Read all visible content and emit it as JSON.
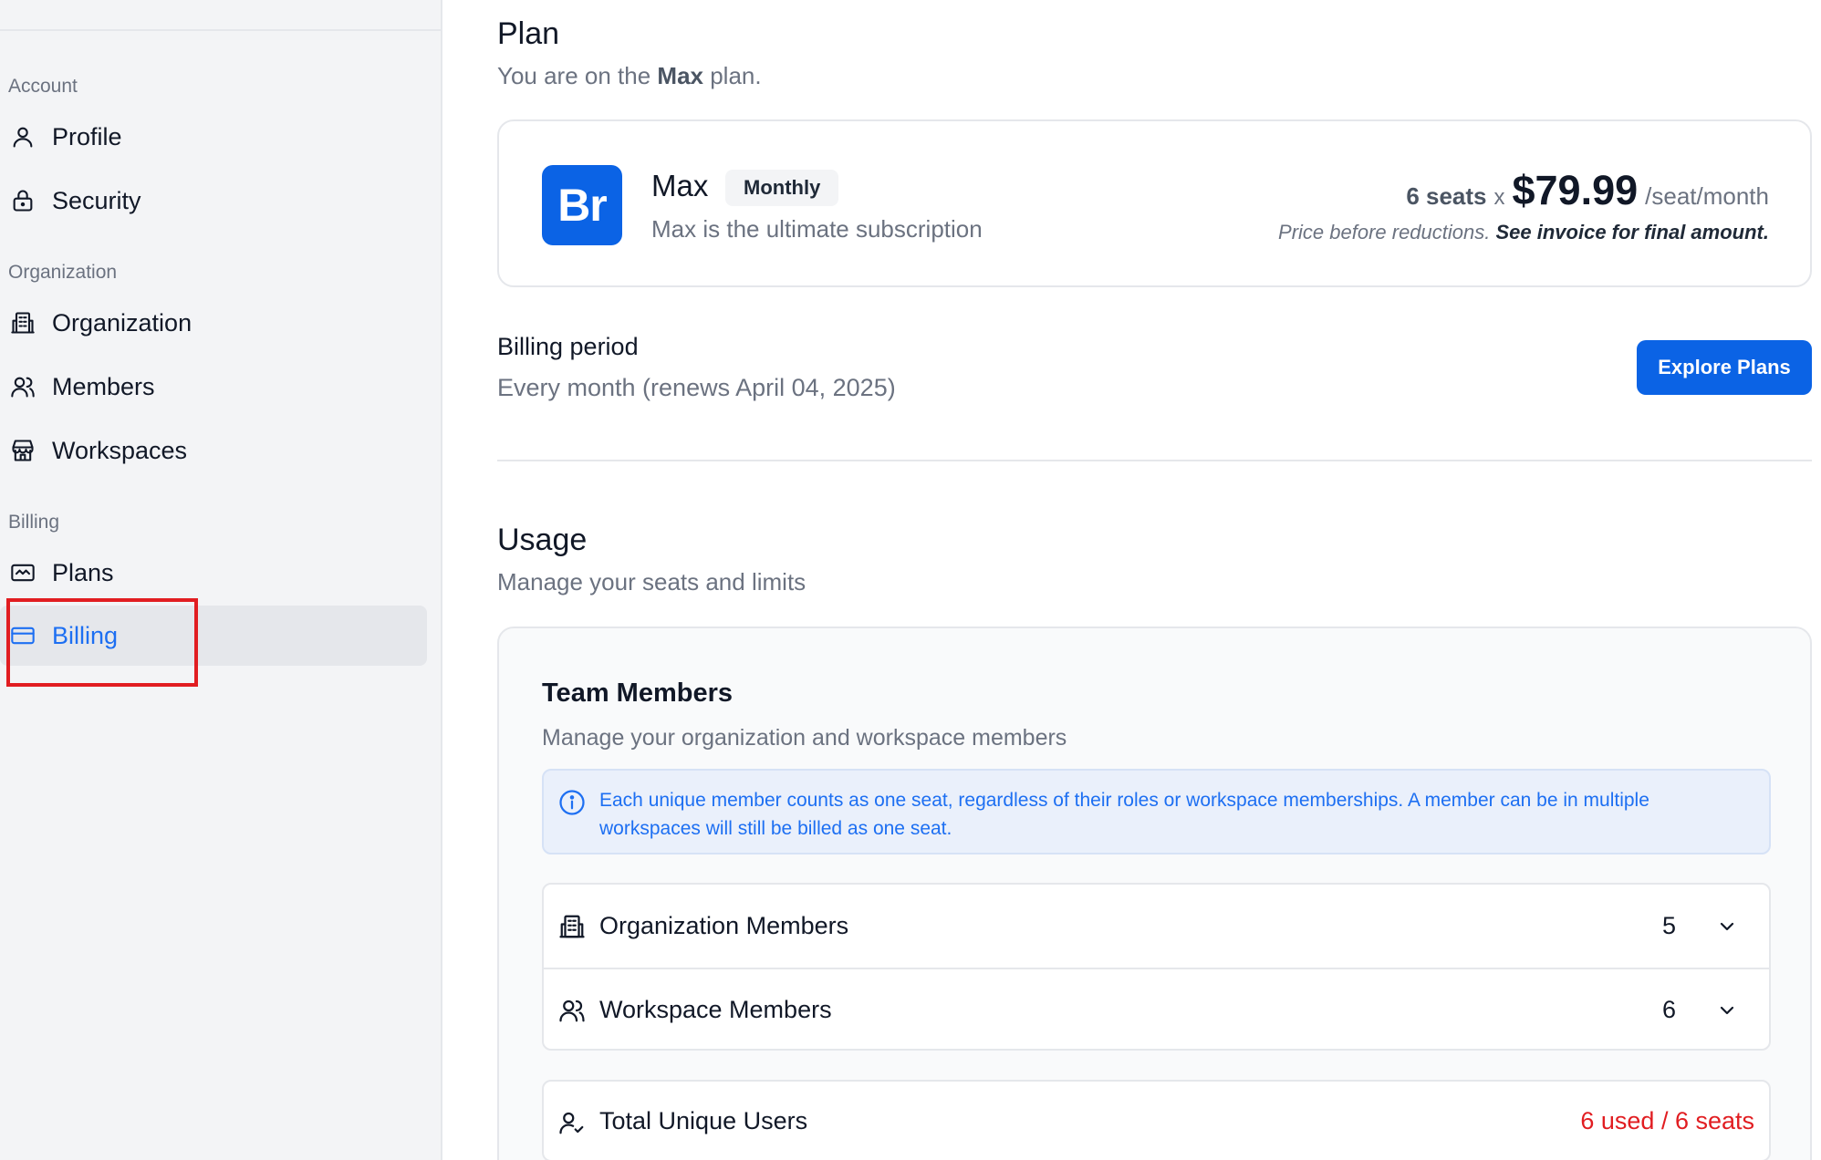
{
  "sidebar": {
    "sections": {
      "account": "Account",
      "organization": "Organization",
      "billing": "Billing"
    },
    "items": {
      "profile": "Profile",
      "security": "Security",
      "organization": "Organization",
      "members": "Members",
      "workspaces": "Workspaces",
      "plans": "Plans",
      "billing": "Billing"
    },
    "active_item": "Billing"
  },
  "plan": {
    "title": "Plan",
    "subtitle_prefix": "You are on the ",
    "subtitle_plan": "Max",
    "subtitle_suffix": " plan.",
    "logo_text": "Br",
    "name": "Max",
    "badge": "Monthly",
    "description": "Max is the ultimate subscription",
    "seats": "6 seats",
    "times": "x",
    "price": "$79.99",
    "per": "/seat/month",
    "note_prefix": "Price before reductions. ",
    "note_bold": "See invoice for final amount."
  },
  "billing_period": {
    "title": "Billing period",
    "value": "Every month (renews April 04, 2025)",
    "explore_button": "Explore Plans"
  },
  "usage": {
    "title": "Usage",
    "subtitle": "Manage your seats and limits",
    "team_members_title": "Team Members",
    "team_members_subtitle": "Manage your organization and workspace members",
    "info": "Each unique member counts as one seat, regardless of their roles or workspace memberships. A member can be in multiple workspaces will still be billed as one seat.",
    "rows": [
      {
        "label": "Organization Members",
        "count": "5"
      },
      {
        "label": "Workspace Members",
        "count": "6"
      }
    ],
    "total_label": "Total Unique Users",
    "total_value": "6 used / 6 seats"
  },
  "colors": {
    "accent": "#0b63e5",
    "active_link": "#1d6ff2",
    "danger": "#e11d21"
  }
}
